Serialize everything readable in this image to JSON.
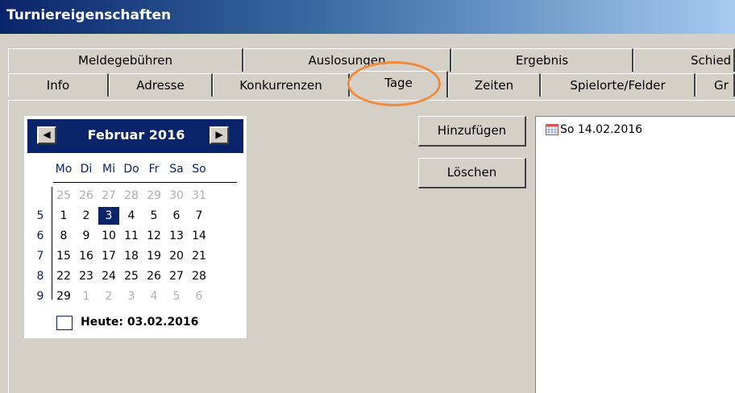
{
  "window": {
    "title": "Turniereigenschaften"
  },
  "tabs": {
    "row_back": [
      "Meldegebühren",
      "Auslosungen",
      "Ergebnis",
      "Schied"
    ],
    "row_front": [
      "Info",
      "Adresse",
      "Konkurrenzen",
      "Tage",
      "Zeiten",
      "Spielorte/Felder",
      "Gr"
    ],
    "active": "Tage"
  },
  "calendar": {
    "month_label": "Februar 2016",
    "prev_icon": "left-arrow-icon",
    "next_icon": "right-arrow-icon",
    "weekdays": [
      "Mo",
      "Di",
      "Mi",
      "Do",
      "Fr",
      "Sa",
      "So"
    ],
    "weeks": [
      {
        "week": "",
        "days": [
          "25",
          "26",
          "27",
          "28",
          "29",
          "30",
          "31"
        ],
        "other": [
          true,
          true,
          true,
          true,
          true,
          true,
          true
        ]
      },
      {
        "week": "5",
        "days": [
          "1",
          "2",
          "3",
          "4",
          "5",
          "6",
          "7"
        ],
        "other": [
          false,
          false,
          false,
          false,
          false,
          false,
          false
        ]
      },
      {
        "week": "6",
        "days": [
          "8",
          "9",
          "10",
          "11",
          "12",
          "13",
          "14"
        ],
        "other": [
          false,
          false,
          false,
          false,
          false,
          false,
          false
        ]
      },
      {
        "week": "7",
        "days": [
          "15",
          "16",
          "17",
          "18",
          "19",
          "20",
          "21"
        ],
        "other": [
          false,
          false,
          false,
          false,
          false,
          false,
          false
        ]
      },
      {
        "week": "8",
        "days": [
          "22",
          "23",
          "24",
          "25",
          "26",
          "27",
          "28"
        ],
        "other": [
          false,
          false,
          false,
          false,
          false,
          false,
          false
        ]
      },
      {
        "week": "9",
        "days": [
          "29",
          "1",
          "2",
          "3",
          "4",
          "5",
          "6"
        ],
        "other": [
          false,
          true,
          true,
          true,
          true,
          true,
          true
        ]
      }
    ],
    "selected_day": "3",
    "today_label": "Heute: 03.02.2016"
  },
  "buttons": {
    "add": "Hinzufügen",
    "delete": "Löschen"
  },
  "days_list": [
    {
      "icon": "calendar-icon",
      "label": "So 14.02.2016"
    }
  ],
  "colors": {
    "accent": "#0a246a",
    "highlight_ring": "#f28a3c"
  }
}
